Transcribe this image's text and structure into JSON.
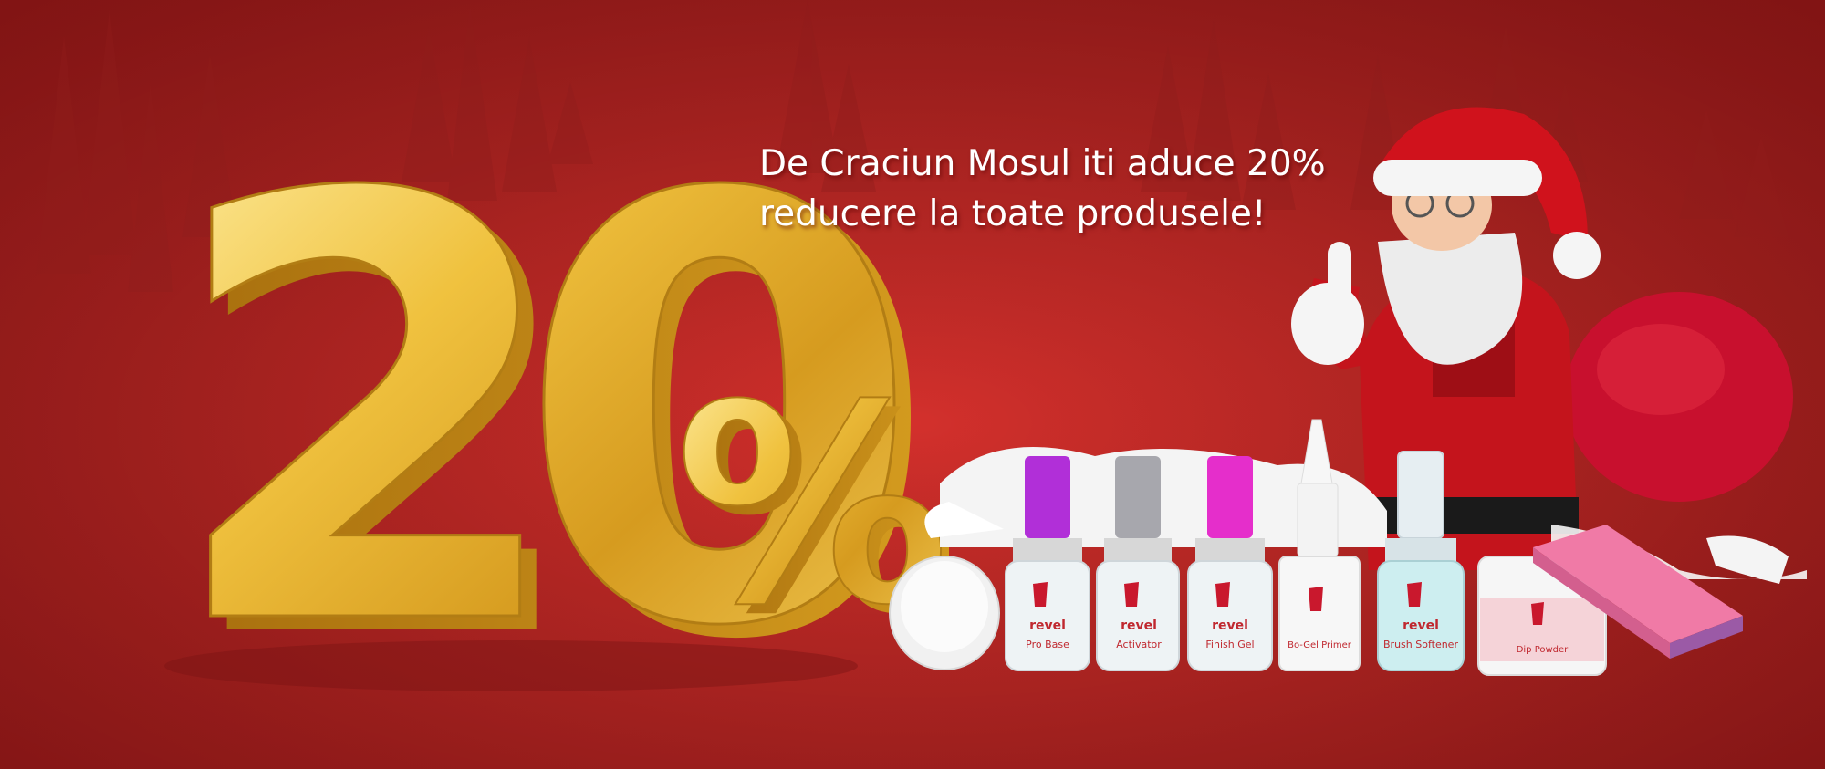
{
  "banner": {
    "headline_line1": "De Craciun Mosul iti aduce 20%",
    "headline_line2": "reducere la toate produsele!",
    "discount_big": "20",
    "percent_sign": "%",
    "colors": {
      "background": "#c52a27",
      "gold": "#e8b93a",
      "text": "#ffffff"
    }
  },
  "products": {
    "brand": "revel",
    "items": [
      {
        "label": "Pro Base",
        "cap_color": "#b12fd8",
        "cap": "purple-cap-icon"
      },
      {
        "label": "Activator",
        "cap_color": "#a7a7ad",
        "cap": "silver-cap-icon"
      },
      {
        "label": "Finish Gel",
        "cap_color": "#e52ecb",
        "cap": "pink-cap-icon"
      },
      {
        "label": "Bo-Gel Primer",
        "cap_color": "#f3f3f3",
        "cap": "white-nozzle-icon"
      },
      {
        "label": "Brush Softener",
        "cap_color": "#d4e6ec",
        "cap": "clear-cap-icon"
      },
      {
        "label": "Dip Powder",
        "cap_color": "#f6f6f6",
        "cap": "jar-icon"
      }
    ]
  }
}
